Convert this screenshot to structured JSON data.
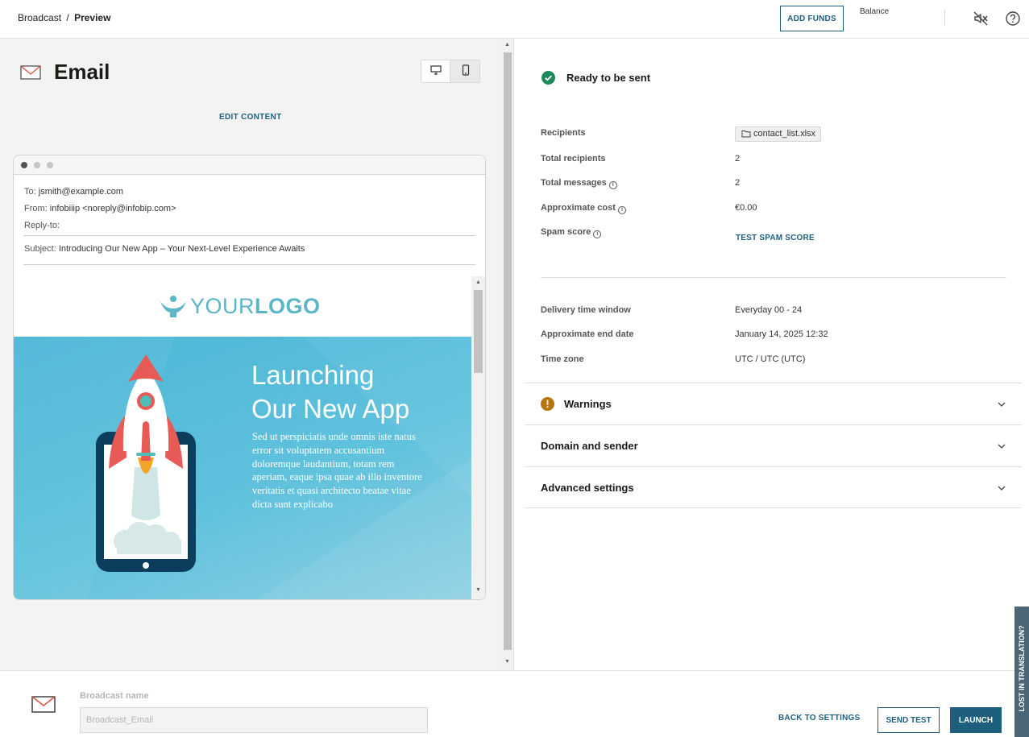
{
  "breadcrumb": {
    "parent": "Broadcast",
    "separator": "/",
    "current": "Preview"
  },
  "topbar": {
    "add_funds": "ADD FUNDS",
    "balance_label": "Balance"
  },
  "left": {
    "title": "Email",
    "edit_content": "EDIT CONTENT",
    "preview": {
      "to_label": "To:",
      "to_value": "jsmith@example.com",
      "from_label": "From:",
      "from_value": "infobiiip <noreply@infobip.com>",
      "reply_label": "Reply-to:",
      "subject_label": "Subject:",
      "subject_value": "Introducing Our New App – Your Next-Level Experience Awaits",
      "logo_light": "YOUR",
      "logo_bold": "LOGO",
      "hero_title_1": "Launching",
      "hero_title_2": "Our New App",
      "hero_body": "Sed ut perspiciatis unde omnis iste natus error sit voluptatem accusantium doloremque laudantium, totam rem aperiam, eaque ipsa quae ab illo inventore veritatis et quasi architecto beatae vitae dicta sunt explicabo"
    }
  },
  "right": {
    "status": "Ready to be sent",
    "recipients_label": "Recipients",
    "recipients_file": "contact_list.xlsx",
    "total_recipients_label": "Total recipients",
    "total_recipients_value": "2",
    "total_messages_label": "Total messages",
    "total_messages_value": "2",
    "approx_cost_label": "Approximate cost",
    "approx_cost_value": "€0.00",
    "spam_label": "Spam score",
    "spam_link": "TEST SPAM SCORE",
    "delivery_label": "Delivery time window",
    "delivery_value": "Everyday 00 - 24",
    "end_date_label": "Approximate end date",
    "end_date_value": "January 14, 2025 12:32",
    "timezone_label": "Time zone",
    "timezone_value": "UTC / UTC (UTC)",
    "sections": [
      "Warnings",
      "Domain and sender",
      "Advanced settings"
    ]
  },
  "bottom": {
    "bname_label": "Broadcast name",
    "bname_value": "Broadcast_Email",
    "back": "BACK TO SETTINGS",
    "send_test": "SEND TEST",
    "launch": "LAUNCH"
  },
  "feedback_tab": "LOST IN TRANSLATION?",
  "colors": {
    "accent": "#1f5f7e",
    "success": "#1e8a5a",
    "warning": "#b6750f",
    "hero": "#4bb6d7"
  }
}
